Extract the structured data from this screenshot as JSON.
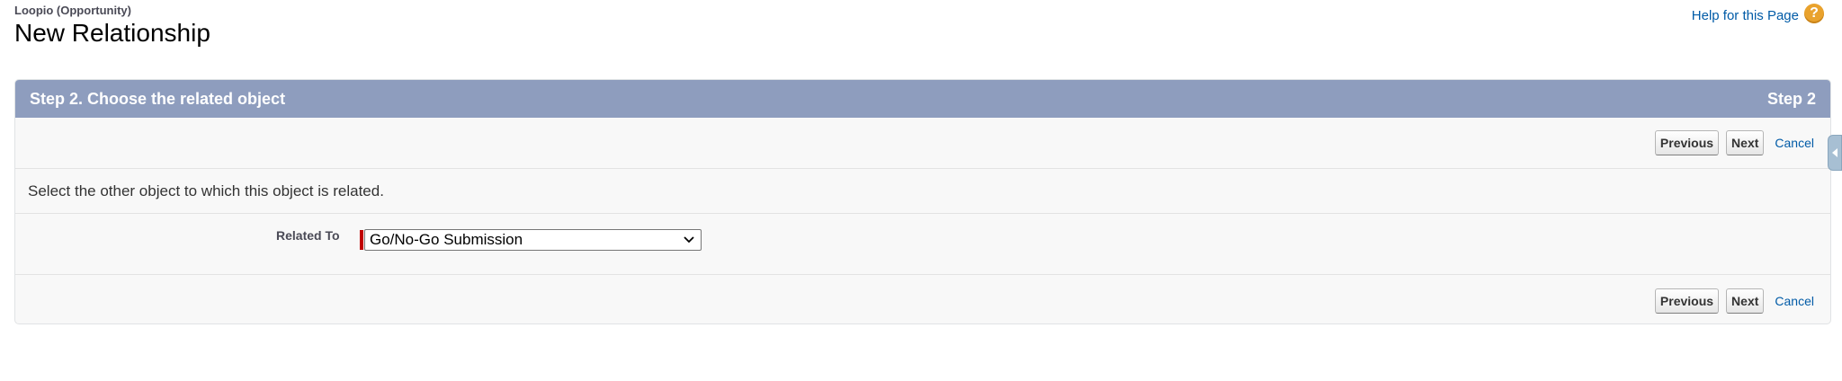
{
  "header": {
    "object_name": "Loopio (Opportunity)",
    "title": "New Relationship",
    "help_link": "Help for this Page",
    "help_icon": "?"
  },
  "step": {
    "title": "Step 2. Choose the related object",
    "indicator": "Step 2",
    "instructions": "Select the other object to which this object is related."
  },
  "buttons": {
    "previous": "Previous",
    "next": "Next",
    "cancel": "Cancel"
  },
  "field": {
    "label": "Related To",
    "selected_value": "Go/No-Go Submission"
  },
  "colors": {
    "header_bar": "#8e9dbe",
    "link": "#015ba7",
    "required": "#c00000",
    "help_icon": "#e9a22d"
  }
}
